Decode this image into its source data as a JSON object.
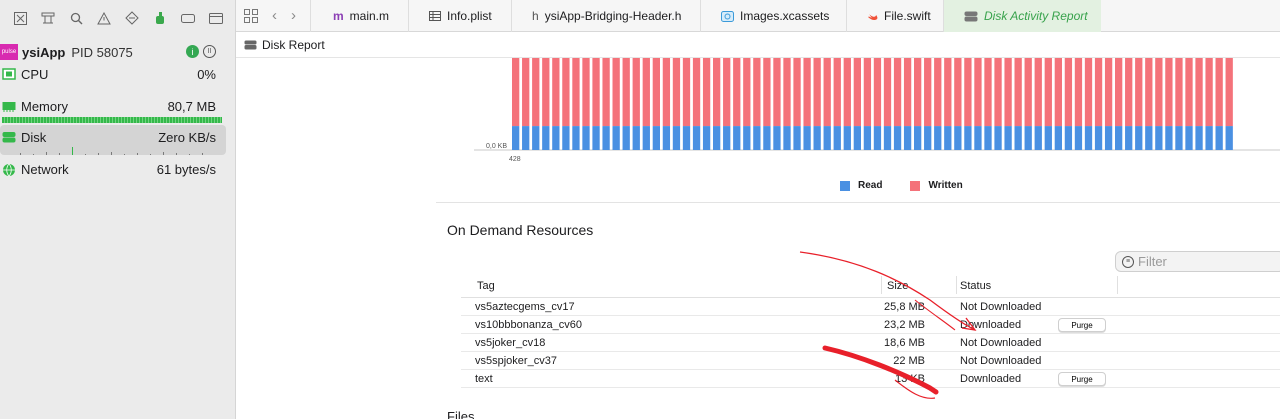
{
  "navigator": {
    "toolbar_icons": [
      "close-icon",
      "hierarchy-icon",
      "search-icon",
      "warning-icon",
      "diamond-icon",
      "spray-icon",
      "tag-icon",
      "list-icon"
    ],
    "process": {
      "name": "ysiApp",
      "pid_label": "PID 58075",
      "icon_text": "pulse"
    },
    "gauges": [
      {
        "label": "CPU",
        "value": "0%"
      },
      {
        "label": "Memory",
        "value": "80,7 MB"
      },
      {
        "label": "Disk",
        "value": "Zero KB/s"
      },
      {
        "label": "Network",
        "value": "61 bytes/s"
      }
    ]
  },
  "tabs": [
    {
      "label": "main.m",
      "icon": "m"
    },
    {
      "label": "Info.plist",
      "icon": "table-icon"
    },
    {
      "label": "ysiApp-Bridging-Header.h",
      "icon": "h"
    },
    {
      "label": "Images.xcassets",
      "icon": "assets-icon"
    },
    {
      "label": "File.swift",
      "icon": "swift-icon"
    },
    {
      "label": "Disk Activity Report",
      "icon": "disk-icon"
    }
  ],
  "editor": {
    "header": "Disk Report"
  },
  "chart_data": {
    "type": "bar",
    "stacked": true,
    "bar_count": 72,
    "series": [
      {
        "name": "Read",
        "color": "#4a90e2",
        "share": 0.26
      },
      {
        "name": "Written",
        "color": "#f4727a",
        "share": 0.74
      }
    ],
    "y_tick_label": "0,0 KB",
    "x_tick_label": "428",
    "legend_position": "bottom-center"
  },
  "odr": {
    "title": "On Demand Resources",
    "filter_placeholder": "Filter",
    "columns": {
      "tag": "Tag",
      "size": "Size",
      "status": "Status"
    },
    "rows": [
      {
        "tag": "vs5aztecgems_cv17",
        "size": "25,8 MB",
        "status": "Not Downloaded"
      },
      {
        "tag": "vs10bbbonanza_cv60",
        "size": "23,2 MB",
        "status": "Downloaded",
        "action": "Purge"
      },
      {
        "tag": "vs5joker_cv18",
        "size": "18,6 MB",
        "status": "Not Downloaded"
      },
      {
        "tag": "vs5spjoker_cv37",
        "size": "22 MB",
        "status": "Not Downloaded"
      },
      {
        "tag": "text",
        "size": "13 KB",
        "status": "Downloaded",
        "action": "Purge"
      }
    ]
  },
  "files_title": "Files",
  "colors": {
    "accent_green": "#37a24b",
    "read": "#4a90e2",
    "written": "#f4727a",
    "annotation": "#e8202a"
  }
}
